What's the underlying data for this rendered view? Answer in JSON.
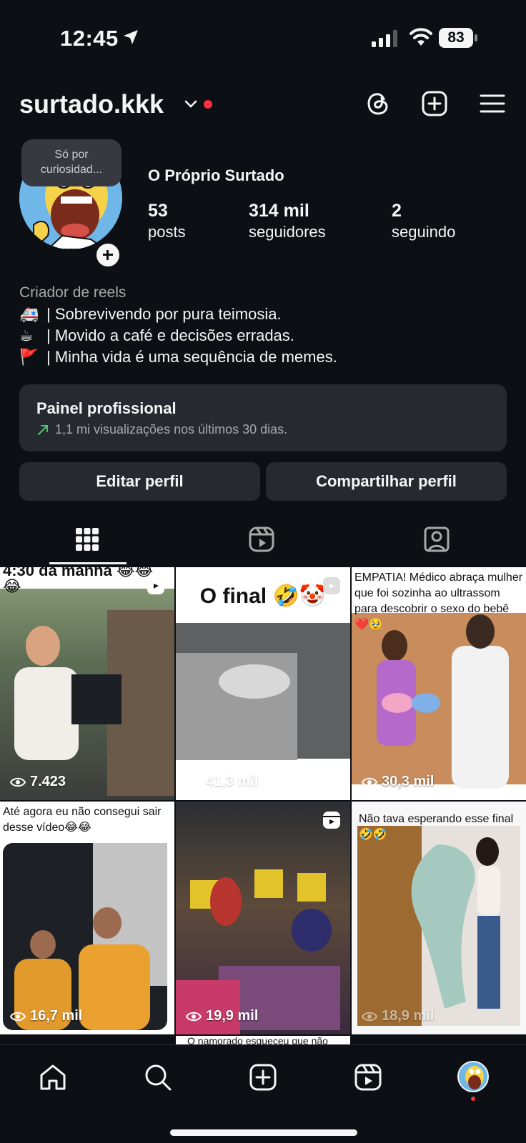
{
  "status_bar": {
    "time": "12:45",
    "battery": "83"
  },
  "header": {
    "username": "surtado.kkk"
  },
  "profile": {
    "note": [
      "Só por",
      "curiosidad..."
    ],
    "full_name": "O Próprio Surtado",
    "stats": {
      "posts": {
        "value": "53",
        "label": "posts"
      },
      "followers": {
        "value": "314 mil",
        "label": "seguidores"
      },
      "following": {
        "value": "2",
        "label": "seguindo"
      }
    },
    "category": "Criador de reels",
    "bio": [
      {
        "emoji": "🚑",
        "text": "| Sobrevivendo por pura teimosia."
      },
      {
        "emoji": "☕",
        "text": "| Movido a café e decisões erradas."
      },
      {
        "emoji": "🚩",
        "text": "| Minha vida é uma sequência de memes."
      }
    ]
  },
  "dashboard": {
    "title": "Painel profissional",
    "subtitle": "1,1 mi visualizações nos últimos 30 dias.",
    "trend_color": "#4cc86a"
  },
  "buttons": {
    "edit": "Editar perfil",
    "share": "Compartilhar perfil"
  },
  "tabs": [
    "grid-icon",
    "reels-icon",
    "tagged-icon"
  ],
  "posts": [
    {
      "caption": "4:30 da manhã 😂😂😂",
      "views": "7.423"
    },
    {
      "caption": "O final 🤣🤡",
      "views": "41,3 mil"
    },
    {
      "caption": "EMPATIA! Médico abraça mulher que foi sozinha ao ultrassom para descobrir o sexo do bebê ❤️🥹",
      "views": "30,3 mil"
    },
    {
      "caption": "Até agora eu não consegui sair desse vídeo😂😂",
      "views": "16,7 mil"
    },
    {
      "caption": "",
      "views": "19,9 mil"
    },
    {
      "caption": "Não tava esperando esse final 🤣🤣",
      "views": "18,9 mil"
    }
  ],
  "next_row_caption": "O namorado esqueceu que não",
  "bottom_nav": [
    "home-icon",
    "search-icon",
    "create-icon",
    "reels-icon",
    "profile-avatar"
  ]
}
